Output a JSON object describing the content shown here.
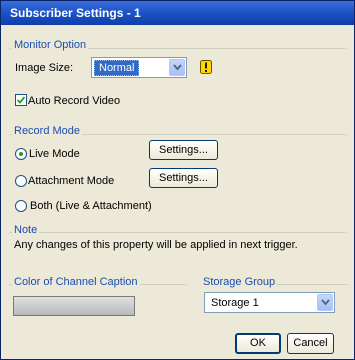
{
  "window": {
    "title": "Subscriber Settings - 1"
  },
  "monitor_option": {
    "group_label": "Monitor Option",
    "image_size_label": "Image Size:",
    "image_size_value": "Normal",
    "auto_record_label": "Auto Record Video",
    "auto_record_checked": true
  },
  "record_mode": {
    "group_label": "Record Mode",
    "live_label": "Live Mode",
    "attachment_label": "Attachment Mode",
    "both_label": "Both (Live & Attachment)",
    "selected": "live",
    "settings_label": "Settings..."
  },
  "note": {
    "group_label": "Note",
    "text": "Any changes of this property will be applied in next trigger."
  },
  "caption_color": {
    "label": "Color of Channel Caption"
  },
  "storage": {
    "label": "Storage Group",
    "value": "Storage 1"
  },
  "footer": {
    "ok_label": "OK",
    "cancel_label": "Cancel"
  },
  "colors": {
    "title_bar": "#1e54c8",
    "group_label": "#1a4db0",
    "dialog_bg": "#ece9d8",
    "radio_dot": "#21a121",
    "warn_icon": "#ffd800"
  },
  "icons": [
    "dropdown-arrow-icon",
    "warning-icon",
    "checkmark-icon"
  ]
}
